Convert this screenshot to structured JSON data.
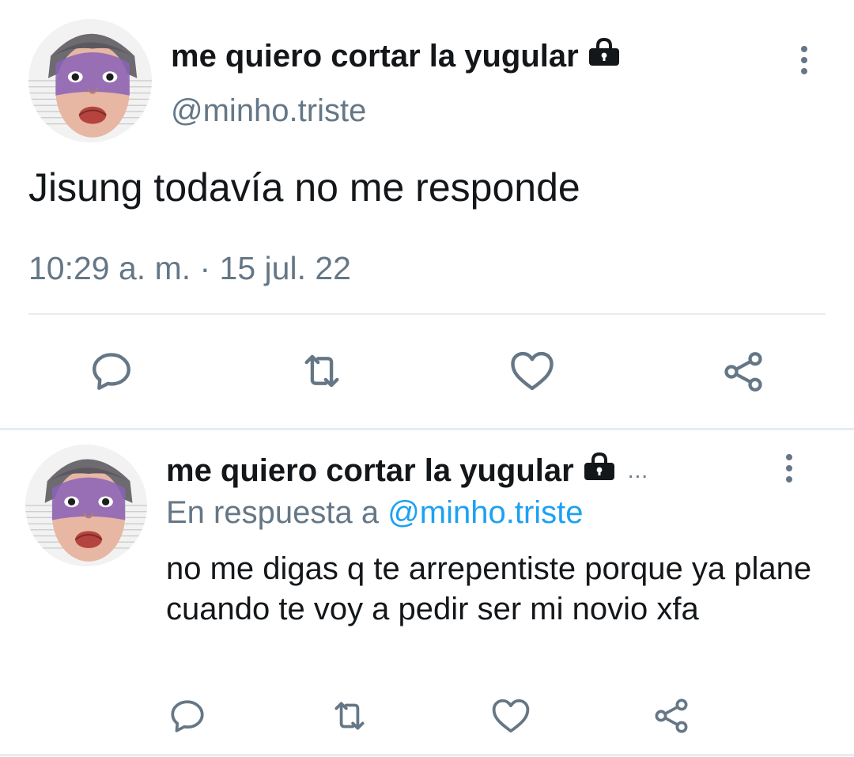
{
  "tweet": {
    "author_name": "me quiero cortar la yugular",
    "handle": "@minho.triste",
    "text": "Jisung todavía no me responde",
    "timestamp": "10:29 a. m. · 15 jul. 22",
    "actions": [
      "reply-icon",
      "retweet-icon",
      "like-icon",
      "share-icon"
    ]
  },
  "reply": {
    "author_name": "me quiero cortar la yugular",
    "truncation": "...",
    "reply_prefix": "En respuesta a",
    "reply_handle": "@minho.triste",
    "text": "no me digas q te arrepentiste porque ya plane cuando te voy a pedir ser mi novio xfa",
    "actions": [
      "reply-icon",
      "retweet-icon",
      "like-icon",
      "share-icon"
    ]
  },
  "colors": {
    "text_primary": "#14171a",
    "text_secondary": "#657786",
    "accent": "#1da1f2",
    "divider": "#e6ecf0"
  }
}
